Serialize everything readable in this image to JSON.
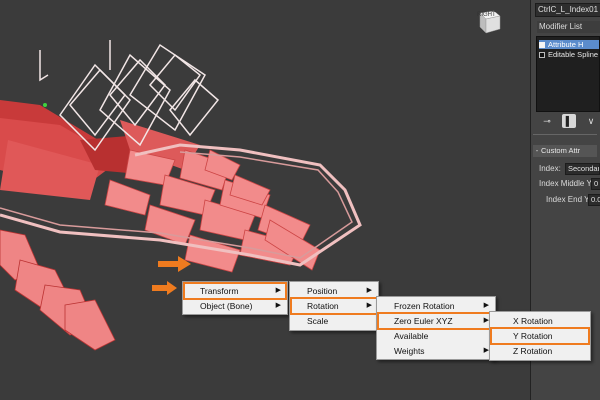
{
  "object_name": "CtrlC_L_Index01",
  "modifier_list_label": "Modifier List",
  "modifier_stack": [
    {
      "label": "Attribute H",
      "selected": true,
      "icon": "lightbulb-icon"
    },
    {
      "label": "Editable Spline",
      "selected": false,
      "icon": "box-icon"
    }
  ],
  "stack_tools": [
    "pin-stack-icon",
    "show-end-result-icon",
    "make-unique-icon"
  ],
  "rollout": {
    "title": "Custom Attr"
  },
  "properties": [
    {
      "label": "Index:",
      "value": "Secondar"
    },
    {
      "label": "Index Middle Y:",
      "value": "0"
    },
    {
      "label": "Index End Y:",
      "value": "0.0"
    }
  ],
  "viewcube_label": "RIGHT",
  "menus": {
    "level1": [
      "Transform",
      "Object (Bone)"
    ],
    "level2": [
      "Position",
      "Rotation",
      "Scale"
    ],
    "level3": [
      "Frozen Rotation",
      "Zero Euler XYZ",
      "Available",
      "Weights"
    ],
    "level4": [
      "X Rotation",
      "Y Rotation",
      "Z Rotation"
    ]
  },
  "highlight_color": "#ef7b1f",
  "bone_color": "#e87878"
}
